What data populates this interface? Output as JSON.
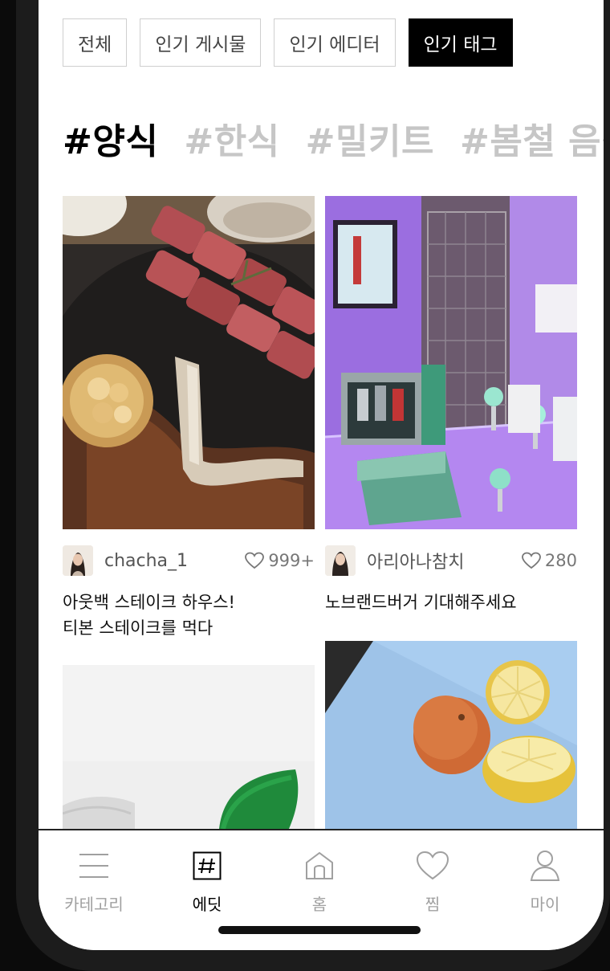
{
  "tabs": [
    {
      "label": "전체",
      "active": false
    },
    {
      "label": "인기 게시물",
      "active": false
    },
    {
      "label": "인기 에디터",
      "active": false
    },
    {
      "label": "인기 태그",
      "active": true
    }
  ],
  "hashtags": [
    {
      "label": "#양식",
      "active": true
    },
    {
      "label": "#한식",
      "active": false
    },
    {
      "label": "#밀키트",
      "active": false
    },
    {
      "label": "#봄철 음식",
      "active": false
    }
  ],
  "posts": [
    {
      "username": "chacha_1",
      "likes": "999+",
      "title_line1": "아웃백 스테이크 하우스!",
      "title_line2": "티본 스테이크를 먹다",
      "image": "steak-photo"
    },
    {
      "username": "아리아나참치",
      "likes": "280",
      "title_line1": "노브랜드버거 기대해주세요",
      "title_line2": "",
      "image": "popup-store-photo"
    },
    {
      "image": "green-chair-photo"
    },
    {
      "image": "citrus-fruit-photo"
    }
  ],
  "nav": [
    {
      "label": "카테고리",
      "icon": "menu-icon",
      "active": false
    },
    {
      "label": "에딧",
      "icon": "hash-icon",
      "active": true
    },
    {
      "label": "홈",
      "icon": "home-icon",
      "active": false
    },
    {
      "label": "찜",
      "icon": "heart-icon",
      "active": false
    },
    {
      "label": "마이",
      "icon": "person-icon",
      "active": false
    }
  ],
  "colors": {
    "accent": "#000000",
    "inactive": "#a0a0a0",
    "tag_inactive": "#c6c6c6"
  }
}
